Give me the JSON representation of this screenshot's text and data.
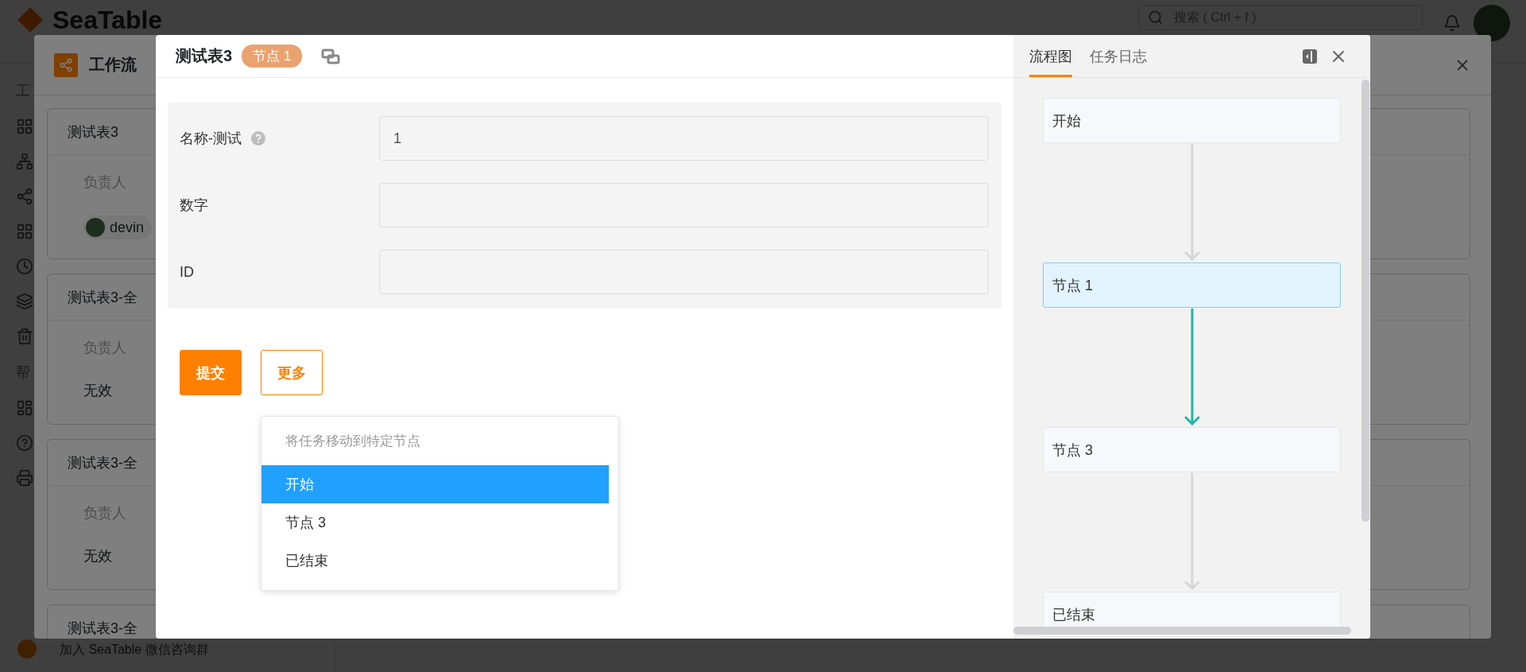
{
  "background_app": {
    "logo": "SeaTable",
    "search": {
      "placeholder": "搜索 ( Ctrl + f )"
    },
    "sidebar": {
      "section_labels": [
        "工",
        "帮"
      ],
      "footer": "加入 SeaTable 微信咨询群"
    }
  },
  "workflow_dialog": {
    "title": "工作流",
    "cards": [
      {
        "title": "测试表3",
        "assignee_label": "负责人",
        "assignee": {
          "kind": "user",
          "name": "devin"
        }
      },
      {
        "title": "测试表3-全",
        "assignee_label": "负责人",
        "assignee": {
          "kind": "text",
          "name": "无效"
        }
      },
      {
        "title": "测试表3-全",
        "assignee_label": "负责人",
        "assignee": {
          "kind": "text",
          "name": "无效"
        }
      },
      {
        "title": "测试表3-全"
      }
    ]
  },
  "task_modal": {
    "title": "测试表3",
    "node_badge": "节点 1",
    "fields": [
      {
        "label": "名称-测试",
        "help": true,
        "value": "1"
      },
      {
        "label": "数字",
        "help": false
      },
      {
        "label": "ID",
        "help": false
      }
    ],
    "buttons": [
      {
        "label": "提交",
        "kind": "primary"
      },
      {
        "label": "更多",
        "kind": "outline"
      }
    ],
    "dropdown": {
      "header": "将任务移动到特定节点",
      "items": [
        {
          "label": "开始",
          "selected": true
        },
        {
          "label": "节点 3",
          "selected": false
        },
        {
          "label": "已结束",
          "selected": false
        }
      ]
    }
  },
  "side_panel": {
    "tabs": [
      {
        "label": "流程图",
        "selected": true
      },
      {
        "label": "任务日志",
        "selected": false
      }
    ],
    "flow_nodes": [
      {
        "label": "开始",
        "current": false
      },
      {
        "label": "节点 1",
        "current": true
      },
      {
        "label": "节点 3",
        "current": false
      },
      {
        "label": "已结束",
        "current": false
      }
    ]
  }
}
